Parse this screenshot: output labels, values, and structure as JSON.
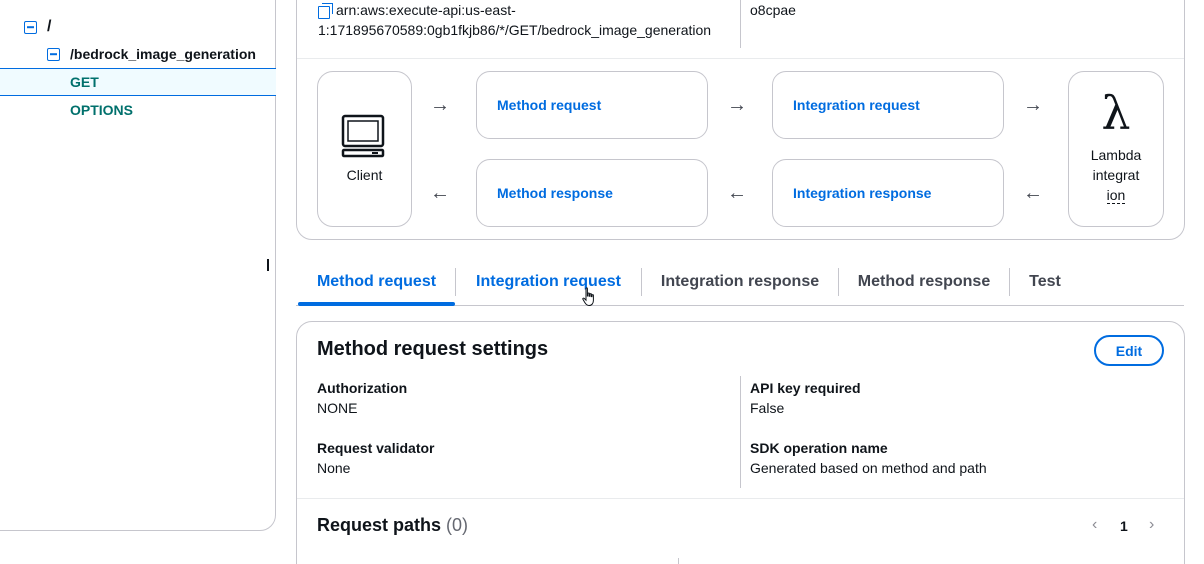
{
  "tree": {
    "root": "/",
    "resource": "/bedrock_image_generation",
    "methods": [
      "GET",
      "OPTIONS"
    ]
  },
  "stage_info": {
    "arn_line1": "arn:aws:execute-api:us-east-",
    "arn_line2": "1:171895670589:0gb1fkjb86/*/GET/bedrock_image_generation",
    "resource_id": "o8cpae"
  },
  "flow": {
    "client": "Client",
    "method_request": "Method request",
    "integration_request": "Integration request",
    "method_response": "Method response",
    "integration_response": "Integration response",
    "lambda_l1": "Lambda",
    "lambda_l2": "integrat",
    "lambda_l3": "ion",
    "arrow_right": "→",
    "arrow_left": "←",
    "lambda_glyph": "λ"
  },
  "tabs": [
    "Method request",
    "Integration request",
    "Integration response",
    "Method response",
    "Test"
  ],
  "settings": {
    "title": "Method request settings",
    "edit": "Edit",
    "authorization_label": "Authorization",
    "authorization_value": "NONE",
    "api_key_label": "API key required",
    "api_key_value": "False",
    "validator_label": "Request validator",
    "validator_value": "None",
    "sdk_label": "SDK operation name",
    "sdk_value": "Generated based on method and path"
  },
  "request_paths": {
    "title": "Request paths",
    "count": "(0)",
    "page": "1"
  },
  "colors": {
    "accent": "#006ce0",
    "method_green": "#00706c",
    "border": "#c6c6cd"
  }
}
